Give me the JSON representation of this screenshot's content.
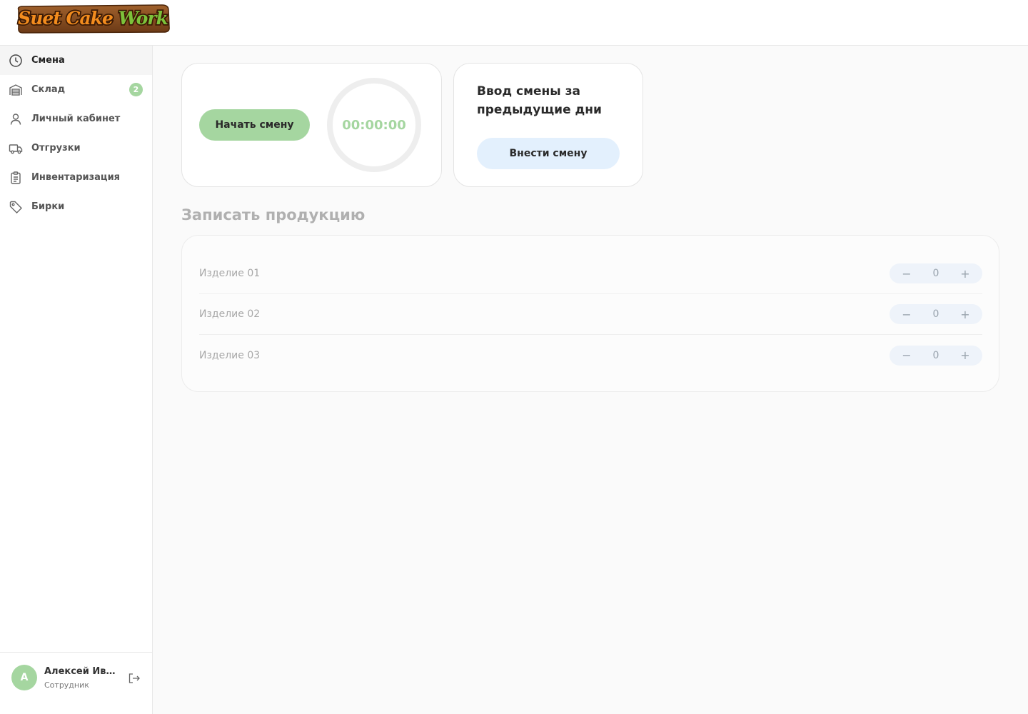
{
  "app": {
    "logo_text": "Suet Cake Work"
  },
  "sidebar": {
    "items": [
      {
        "label": "Смена",
        "icon": "clock-icon",
        "active": true
      },
      {
        "label": "Склад",
        "icon": "warehouse-icon",
        "badge": "2"
      },
      {
        "label": "Личный кабинет",
        "icon": "user-icon"
      },
      {
        "label": "Отгрузки",
        "icon": "truck-icon"
      },
      {
        "label": "Инвентаризация",
        "icon": "clipboard-icon"
      },
      {
        "label": "Бирки",
        "icon": "tag-icon"
      }
    ]
  },
  "user": {
    "initial": "А",
    "name": "Алексей Иван...",
    "role": "Сотрудник"
  },
  "shift": {
    "start_label": "Начать смену",
    "timer": "00:00:00"
  },
  "previous": {
    "title": "Ввод смены за предыдущие дни",
    "button_label": "Внести смену"
  },
  "products": {
    "title": "Записать продукцию",
    "items": [
      {
        "name": "Изделие 01",
        "qty": "0"
      },
      {
        "name": "Изделие 02",
        "qty": "0"
      },
      {
        "name": "Изделие 03",
        "qty": "0"
      }
    ],
    "minus": "−",
    "plus": "+"
  },
  "colors": {
    "accent_green": "#a5d6a0",
    "accent_blue": "#e3f0fd",
    "logo_orange": "#f28c1e",
    "logo_green": "#7cc23a"
  }
}
